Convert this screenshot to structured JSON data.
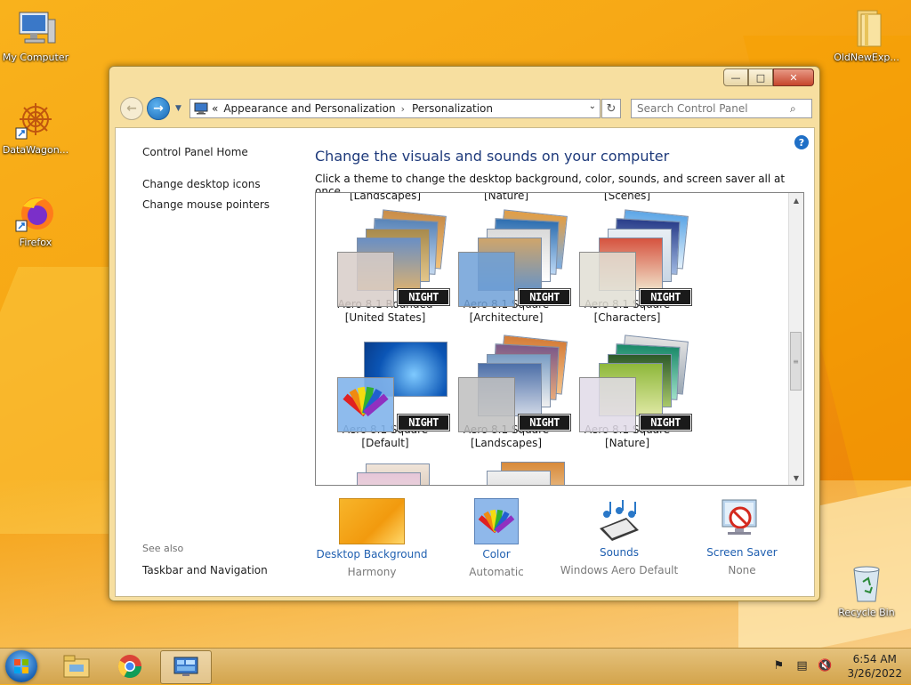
{
  "desktop": {
    "icons": [
      {
        "label": "My Computer"
      },
      {
        "label": "DataWagon..."
      },
      {
        "label": "Firefox"
      },
      {
        "label": "OldNewExp..."
      },
      {
        "label": "Recycle Bin"
      }
    ]
  },
  "window": {
    "controls": {
      "minimize": "—",
      "maximize": "□",
      "close": "✕"
    },
    "address": {
      "prefix": "«",
      "crumbs": [
        "Appearance and Personalization",
        "Personalization"
      ],
      "separator": "›"
    },
    "search": {
      "placeholder": "Search Control Panel"
    },
    "left_pane": {
      "home": "Control Panel Home",
      "links": [
        "Change desktop icons",
        "Change mouse pointers"
      ],
      "see_also": "See also",
      "see_also_links": [
        "Taskbar and Navigation"
      ]
    },
    "help": "?",
    "title": "Change the visuals and sounds on your computer",
    "subtitle": "Click a theme to change the desktop background, color, sounds, and screen saver all at once.",
    "themes_partial_top": [
      "[Landscapes]",
      "[Nature]",
      "[Scenes]"
    ],
    "themes": [
      {
        "line1": "Aero 8.1 Rounded",
        "line2": "[United States]",
        "badge": "NIGHT"
      },
      {
        "line1": "Aero 8.1 Square",
        "line2": "[Architecture]",
        "badge": "NIGHT"
      },
      {
        "line1": "Aero 8.1 Square",
        "line2": "[Characters]",
        "badge": "NIGHT"
      },
      {
        "line1": "Aero 8.1 Square",
        "line2": "[Default]",
        "badge": "NIGHT"
      },
      {
        "line1": "Aero 8.1 Square",
        "line2": "[Landscapes]",
        "badge": "NIGHT"
      },
      {
        "line1": "Aero 8.1 Square",
        "line2": "[Nature]",
        "badge": "NIGHT"
      }
    ],
    "bottom": [
      {
        "label": "Desktop Background",
        "value": "Harmony"
      },
      {
        "label": "Color",
        "value": "Automatic"
      },
      {
        "label": "Sounds",
        "value": "Windows Aero Default"
      },
      {
        "label": "Screen Saver",
        "value": "None"
      }
    ]
  },
  "taskbar": {
    "clock": {
      "time": "6:54 AM",
      "date": "3/26/2022"
    }
  },
  "colors": {
    "accent_link": "#1f5fb0",
    "title_blue": "#1e3a7b",
    "window_frame": "#f7dfa0"
  }
}
